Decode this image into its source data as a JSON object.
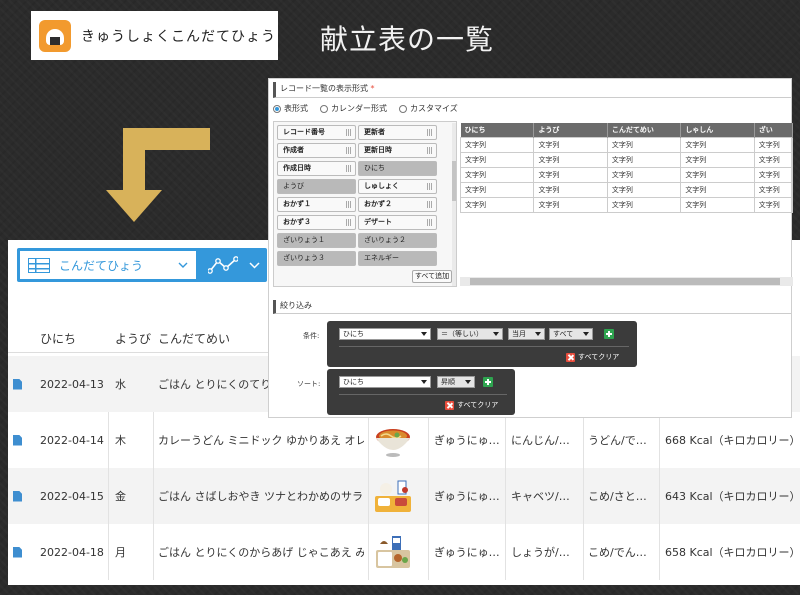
{
  "slide_title": "献立表の一覧",
  "app": {
    "name": "きゅうしょくこんだてひょう",
    "icon": "onigiri-icon",
    "icon_color": "#f29a2e"
  },
  "arrow_color": "#d8b25a",
  "list_view": {
    "view_name": "こんだてひょう",
    "accent": "#3498db",
    "columns": [
      "ひにち",
      "ようび",
      "こんだてめい"
    ],
    "rows": [
      {
        "date": "2022-04-13",
        "day": "水",
        "menu": "ごはん とりにくのてりや",
        "c1": "",
        "c2": "",
        "c3": "",
        "kcal": "",
        "food_icon": ""
      },
      {
        "date": "2022-04-14",
        "day": "木",
        "menu": "カレーうどん ミニドック ゆかりあえ オレ…",
        "c1": "ぎゅうにゅ…",
        "c2": "にんじん/…",
        "c3": "うどん/で…",
        "kcal": "668 Kcal（キロカロリー）",
        "food_icon": "noodle-bowl-icon"
      },
      {
        "date": "2022-04-15",
        "day": "金",
        "menu": "ごはん さばしおやき ツナとわかめのサラ…",
        "c1": "ぎゅうにゅ…",
        "c2": "キャベツ/…",
        "c3": "こめ/さと…",
        "kcal": "643 Kcal（キロカロリー）",
        "food_icon": "lunch-tray-icon"
      },
      {
        "date": "2022-04-18",
        "day": "月",
        "menu": "ごはん とりにくのからあげ じゃこあえ み…",
        "c1": "ぎゅうにゅ…",
        "c2": "しょうが/…",
        "c3": "こめ/でん…",
        "kcal": "658 Kcal（キロカロリー）",
        "food_icon": "bento-icon"
      }
    ]
  },
  "settings": {
    "format_header": "レコード一覧の表示形式",
    "required_mark": "*",
    "radios": [
      {
        "label": "表形式",
        "selected": true
      },
      {
        "label": "カレンダー形式",
        "selected": false
      },
      {
        "label": "カスタマイズ",
        "selected": false
      }
    ],
    "fields": [
      [
        "レコード番号",
        false
      ],
      [
        "更新者",
        false
      ],
      [
        "作成者",
        false
      ],
      [
        "更新日時",
        false
      ],
      [
        "作成日時",
        false
      ],
      [
        "ひにち",
        true
      ],
      [
        "ようび",
        true
      ],
      [
        "しゅしょく",
        false
      ],
      [
        "おかず１",
        false
      ],
      [
        "おかず２",
        false
      ],
      [
        "おかず３",
        false
      ],
      [
        "デザート",
        false
      ],
      [
        "ざいりょう１",
        true
      ],
      [
        "ざいりょう２",
        true
      ],
      [
        "ざいりょう３",
        true
      ],
      [
        "エネルギー",
        true
      ]
    ],
    "add_all": "すべて追加",
    "preview_columns": [
      "ひにち",
      "ようび",
      "こんだてめい",
      "しゃしん",
      "ざい"
    ],
    "preview_cell": "文字列",
    "preview_row_count": 5,
    "filter_header": "絞り込み",
    "condition_label": "条件:",
    "condition": {
      "field": "ひにち",
      "op": "＝（等しい）",
      "value": "当月",
      "scope": "すべて"
    },
    "clear_all": "すべてクリア",
    "sort_label": "ソート:",
    "sort": {
      "field": "ひにち",
      "order": "昇順"
    }
  }
}
